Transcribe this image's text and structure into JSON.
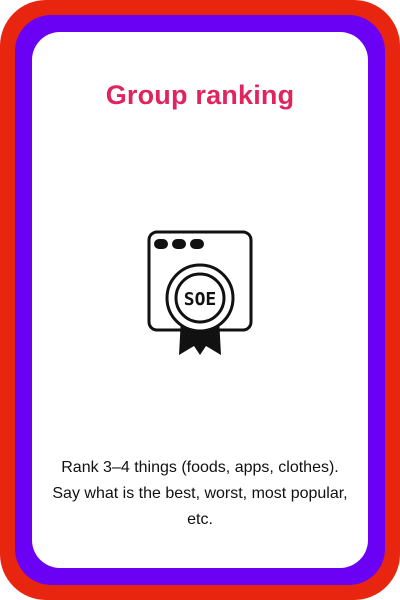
{
  "colors": {
    "outer_border": "#e8250f",
    "inner_border": "#6a00f4",
    "title": "#e0245e",
    "icon_stroke": "#111111"
  },
  "card": {
    "title": "Group ranking",
    "icon": "award-certificate-icon",
    "icon_text": "SOE",
    "description": "Rank 3–4 things (foods, apps, clothes). Say what is the best, worst, most popular, etc."
  }
}
